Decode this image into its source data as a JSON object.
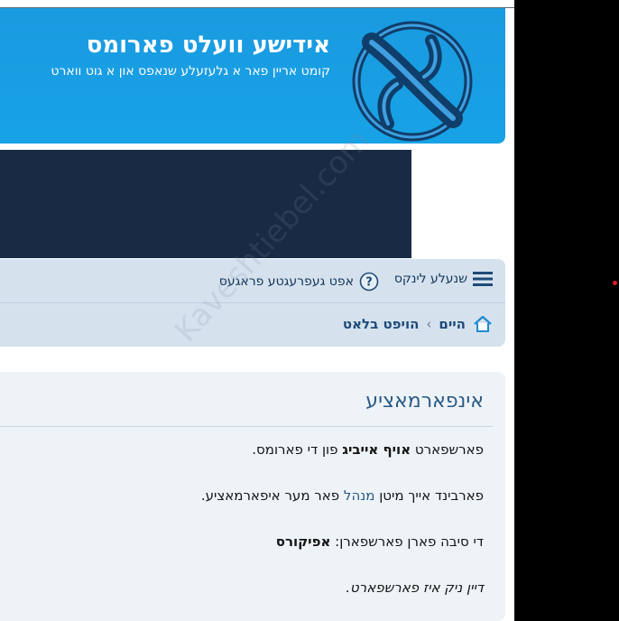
{
  "header": {
    "title": "אידישע וועלט פארומס",
    "subtitle": "קומט אריין פאר א גלעזעלע שנאפס און א גוט ווארט",
    "colors": {
      "header_bg": "#18a2e6",
      "banner": "#182a44"
    }
  },
  "nav": {
    "quick_links": "שנעלע לינקס",
    "quick_links_icon": "hamburger-icon",
    "faq": "אפט געפרעגטע פראגעס",
    "faq_icon": "help-icon"
  },
  "breadcrumb": {
    "home": "היים",
    "home_icon": "home-icon",
    "separator": "‹",
    "board_index": "הויפט בלאט"
  },
  "info": {
    "title": "אינפארמאציע",
    "line1_prefix": "פארשפארט ",
    "line1_strong": "אויף אייביג",
    "line1_suffix": " פון די פארומס.",
    "line2_prefix": "פארבינד אייך מיטן ",
    "line2_link": "מנהל",
    "line2_suffix": " פאר מער איפארמאציע.",
    "line3_prefix": "די סיבה פארן פארשפארן: ",
    "line3_strong": "אפיקורס",
    "line4": "דיין ניק איז פארשפארט."
  },
  "watermark": "Kaveshtiebel.com"
}
